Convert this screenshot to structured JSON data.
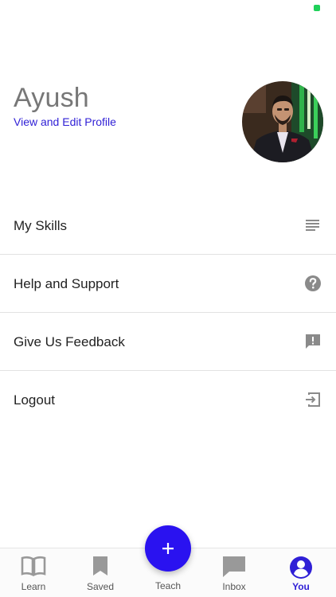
{
  "status_bar": {
    "indicator_color": "#1fd05a"
  },
  "profile": {
    "name": "Ayush",
    "edit_link": "View and Edit Profile",
    "avatar_icon": "avatar-photo"
  },
  "menu": {
    "items": [
      {
        "label": "My Skills",
        "icon": "list-icon"
      },
      {
        "label": "Help and Support",
        "icon": "help-icon"
      },
      {
        "label": "Give Us Feedback",
        "icon": "feedback-icon"
      },
      {
        "label": "Logout",
        "icon": "logout-icon"
      }
    ]
  },
  "tabbar": {
    "tabs": [
      {
        "label": "Learn",
        "icon": "book-icon",
        "active": false
      },
      {
        "label": "Saved",
        "icon": "bookmark-icon",
        "active": false
      },
      {
        "label": "Teach",
        "icon": "plus-icon",
        "active": false
      },
      {
        "label": "Inbox",
        "icon": "chat-icon",
        "active": false
      },
      {
        "label": "You",
        "icon": "user-icon",
        "active": true
      }
    ]
  },
  "colors": {
    "accent": "#2f1fd6",
    "fab": "#2a12f0",
    "icon_gray": "#8a8a8a"
  }
}
